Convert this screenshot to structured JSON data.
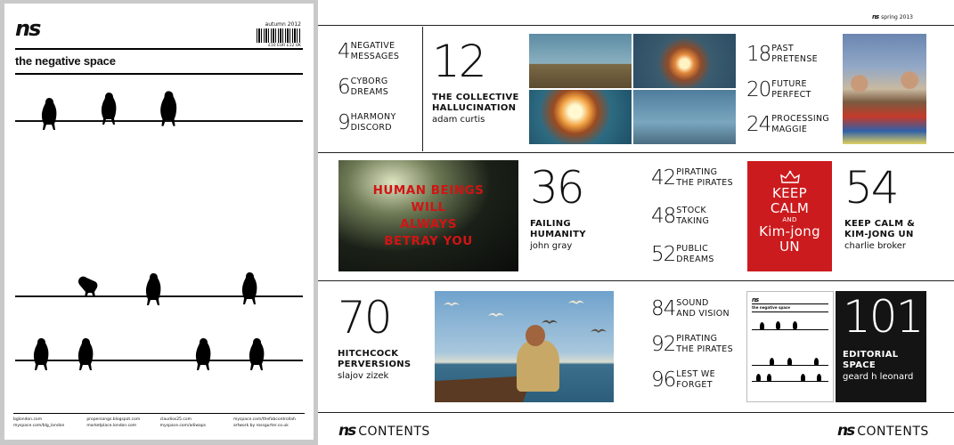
{
  "cover": {
    "logo": "ns",
    "issue": "autumn 2012",
    "price": "£10 EUR £12 UK",
    "title": "the negative space",
    "footer": [
      [
        "bglondon.com",
        "myspace.com/blg_london"
      ],
      [
        "propersongs.blogspot.com",
        "marketplace.london.com"
      ],
      [
        "claudios25.com",
        "myspace.com/adiwaps"
      ],
      [
        "myspace.com/thefabcontrollah",
        "artwork by rossgurter.co.uk"
      ]
    ]
  },
  "spread": {
    "issue_logo": "ns",
    "issue": "spring 2013",
    "small_entries": [
      {
        "num": "4",
        "lines": [
          "NEGATIVE",
          "MESSAGES"
        ]
      },
      {
        "num": "6",
        "lines": [
          "CYBORG",
          "DREAMS"
        ]
      },
      {
        "num": "9",
        "lines": [
          "HARMONY",
          "DISCORD"
        ]
      },
      {
        "num": "18",
        "lines": [
          "PAST",
          "PRETENSE"
        ]
      },
      {
        "num": "20",
        "lines": [
          "FUTURE",
          "PERFECT"
        ]
      },
      {
        "num": "24",
        "lines": [
          "PROCESSING",
          "MAGGIE"
        ]
      },
      {
        "num": "42",
        "lines": [
          "PIRATING",
          "THE PIRATES"
        ]
      },
      {
        "num": "48",
        "lines": [
          "STOCK",
          "TAKING"
        ]
      },
      {
        "num": "52",
        "lines": [
          "PUBLIC",
          "DREAMS"
        ]
      },
      {
        "num": "84",
        "lines": [
          "SOUND",
          "AND VISION"
        ]
      },
      {
        "num": "92",
        "lines": [
          "PIRATING",
          "THE PIRATES"
        ]
      },
      {
        "num": "96",
        "lines": [
          "LEST WE",
          "FORGET"
        ]
      }
    ],
    "features": [
      {
        "num": "12",
        "lines": [
          "THE COLLECTIVE",
          "HALLUCINATION"
        ],
        "author": "adam curtis"
      },
      {
        "num": "36",
        "lines": [
          "FAILING",
          "HUMANITY"
        ],
        "author": "john gray"
      },
      {
        "num": "54",
        "lines": [
          "KEEP CALM &",
          "KIM-JONG UN"
        ],
        "author": "charlie broker"
      },
      {
        "num": "70",
        "lines": [
          "HITCHCOCK",
          "PERVERSIONS"
        ],
        "author": "slajov zizek"
      },
      {
        "num": "101",
        "lines": [
          "EDITORIAL",
          "SPACE"
        ],
        "author": "geard h leonard"
      }
    ],
    "human_text": [
      "HUMAN BEINGS",
      "WILL",
      "ALWAYS",
      "BETRAY YOU"
    ],
    "keep_calm": [
      "KEEP",
      "CALM",
      "AND",
      "Kim-jong",
      "UN"
    ],
    "mini_cover_logo": "ns",
    "mini_cover_title": "the negative space",
    "contents_logo": "ns",
    "contents_label": "CONTENTS"
  }
}
